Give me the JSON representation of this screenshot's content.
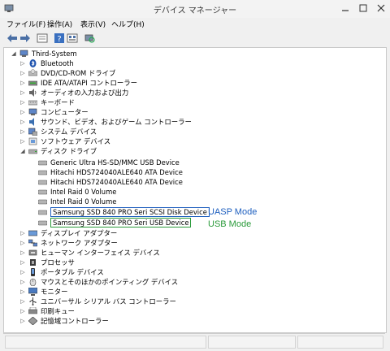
{
  "window": {
    "title": "デバイス マネージャー"
  },
  "menu": {
    "items": [
      "ファイル(F)",
      "操作(A)",
      "表示(V)",
      "ヘルプ(H)"
    ]
  },
  "tree": {
    "root": "Third-System",
    "categories_top": [
      {
        "label": "Bluetooth",
        "icon": "bluetooth-icon"
      },
      {
        "label": "DVD/CD-ROM ドライブ",
        "icon": "dvd-drive-icon"
      },
      {
        "label": "IDE ATA/ATAPI コントローラー",
        "icon": "ide-controller-icon"
      },
      {
        "label": "オーディオの入力および出力",
        "icon": "audio-icon"
      },
      {
        "label": "キーボード",
        "icon": "keyboard-icon"
      },
      {
        "label": "コンピューター",
        "icon": "computer-icon"
      },
      {
        "label": "サウンド、ビデオ、およびゲーム コントローラー",
        "icon": "sound-icon"
      },
      {
        "label": "システム デバイス",
        "icon": "system-device-icon"
      },
      {
        "label": "ソフトウェア デバイス",
        "icon": "software-device-icon"
      }
    ],
    "disk_category": "ディスク ドライブ",
    "disks": [
      "Generic Ultra HS-SD/MMC USB Device",
      "Hitachi HDS724040ALE640 ATA Device",
      "Hitachi HDS724040ALE640 ATA Device",
      "Intel Raid 0 Volume",
      "Intel Raid 0 Volume",
      "Samsung SSD 840 PRO Seri SCSI Disk Device",
      "Samsung SSD 840 PRO Seri USB Device"
    ],
    "categories_bottom": [
      {
        "label": "ディスプレイ アダプター",
        "icon": "display-adapter-icon"
      },
      {
        "label": "ネットワーク アダプター",
        "icon": "network-adapter-icon"
      },
      {
        "label": "ヒューマン インターフェイス デバイス",
        "icon": "hid-icon"
      },
      {
        "label": "プロセッサ",
        "icon": "processor-icon"
      },
      {
        "label": "ポータブル デバイス",
        "icon": "portable-device-icon"
      },
      {
        "label": "マウスとそのほかのポインティング デバイス",
        "icon": "mouse-icon"
      },
      {
        "label": "モニター",
        "icon": "monitor-icon"
      },
      {
        "label": "ユニバーサル シリアル バス コントローラー",
        "icon": "usb-controller-icon"
      },
      {
        "label": "印刷キュー",
        "icon": "print-queue-icon"
      },
      {
        "label": "記憶域コントローラー",
        "icon": "storage-controller-icon"
      }
    ]
  },
  "annotations": {
    "uasp": "UASP Mode",
    "usb": "USB Mode"
  },
  "colors": {
    "uasp": "#1e5fbf",
    "usb": "#2a9a3a"
  }
}
